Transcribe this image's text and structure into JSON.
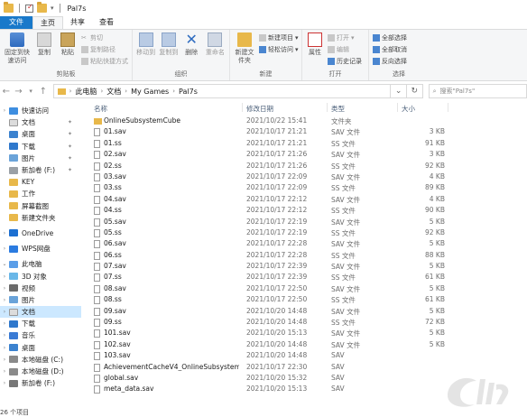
{
  "titlebar": {
    "title": "Pal7s"
  },
  "tabs": [
    {
      "label": "文件"
    },
    {
      "label": "主页"
    },
    {
      "label": "共享"
    },
    {
      "label": "查看"
    }
  ],
  "ribbon": {
    "clipboard": {
      "pin_label": "固定到快速访问",
      "copy_label": "复制",
      "paste_label": "粘贴",
      "cut_label": "剪切",
      "copy_path_label": "复制路径",
      "paste_shortcut_label": "粘贴快捷方式",
      "group_label": "剪贴板"
    },
    "organize": {
      "move_label": "移动到",
      "copy_to_label": "复制到",
      "delete_label": "删除",
      "rename_label": "重命名",
      "group_label": "组织"
    },
    "new": {
      "new_folder_label": "新建文件夹",
      "new_item_label": "新建项目",
      "easy_access_label": "轻松访问",
      "group_label": "新建"
    },
    "open": {
      "properties_label": "属性",
      "open_label": "打开",
      "edit_label": "编辑",
      "history_label": "历史记录",
      "group_label": "打开"
    },
    "select": {
      "select_all_label": "全部选择",
      "select_none_label": "全部取消",
      "invert_label": "反向选择",
      "group_label": "选择"
    }
  },
  "address": {
    "crumbs": [
      "此电脑",
      "文档",
      "My Games",
      "Pal7s"
    ],
    "search_placeholder": "搜索\"Pal7s\""
  },
  "sidebar": {
    "items": [
      {
        "label": "快速访问",
        "icon": "star-icon"
      },
      {
        "label": "文档",
        "icon": "document-icon",
        "pinned": true
      },
      {
        "label": "桌面",
        "icon": "desktop-icon",
        "pinned": true
      },
      {
        "label": "下载",
        "icon": "download-icon",
        "pinned": true
      },
      {
        "label": "图片",
        "icon": "pictures-icon",
        "pinned": true
      },
      {
        "label": "新加卷 (F:)",
        "icon": "drive-icon",
        "pinned": true
      },
      {
        "label": "KEY",
        "icon": "folder-icon"
      },
      {
        "label": "工作",
        "icon": "folder-icon"
      },
      {
        "label": "屏幕截图",
        "icon": "folder-icon"
      },
      {
        "label": "新建文件夹",
        "icon": "folder-icon"
      },
      {
        "label": "OneDrive",
        "icon": "cloud-icon"
      },
      {
        "label": "WPS网盘",
        "icon": "wps-cloud-icon"
      },
      {
        "label": "此电脑",
        "icon": "computer-icon"
      },
      {
        "label": "3D 对象",
        "icon": "3d-objects-icon"
      },
      {
        "label": "视频",
        "icon": "video-icon"
      },
      {
        "label": "图片",
        "icon": "pictures-icon"
      },
      {
        "label": "文档",
        "icon": "document-icon"
      },
      {
        "label": "下载",
        "icon": "download-icon"
      },
      {
        "label": "音乐",
        "icon": "music-icon"
      },
      {
        "label": "桌面",
        "icon": "desktop-icon"
      },
      {
        "label": "本地磁盘 (C:)",
        "icon": "hard-drive-icon"
      },
      {
        "label": "本地磁盘 (D:)",
        "icon": "hard-drive-icon"
      },
      {
        "label": "新加卷 (F:)",
        "icon": "drive-icon"
      }
    ]
  },
  "columns": {
    "name": "名称",
    "date": "修改日期",
    "type": "类型",
    "size": "大小"
  },
  "files": [
    {
      "name": "OnlineSubsystemCube",
      "date": "2021/10/22 15:41",
      "type": "文件夹",
      "size": "",
      "folder": true
    },
    {
      "name": "01.sav",
      "date": "2021/10/17 21:21",
      "type": "SAV 文件",
      "size": "3 KB"
    },
    {
      "name": "01.ss",
      "date": "2021/10/17 21:21",
      "type": "SS 文件",
      "size": "91 KB"
    },
    {
      "name": "02.sav",
      "date": "2021/10/17 21:26",
      "type": "SAV 文件",
      "size": "3 KB"
    },
    {
      "name": "02.ss",
      "date": "2021/10/17 21:26",
      "type": "SS 文件",
      "size": "92 KB"
    },
    {
      "name": "03.sav",
      "date": "2021/10/17 22:09",
      "type": "SAV 文件",
      "size": "4 KB"
    },
    {
      "name": "03.ss",
      "date": "2021/10/17 22:09",
      "type": "SS 文件",
      "size": "89 KB"
    },
    {
      "name": "04.sav",
      "date": "2021/10/17 22:12",
      "type": "SAV 文件",
      "size": "4 KB"
    },
    {
      "name": "04.ss",
      "date": "2021/10/17 22:12",
      "type": "SS 文件",
      "size": "90 KB"
    },
    {
      "name": "05.sav",
      "date": "2021/10/17 22:19",
      "type": "SAV 文件",
      "size": "5 KB"
    },
    {
      "name": "05.ss",
      "date": "2021/10/17 22:19",
      "type": "SS 文件",
      "size": "92 KB"
    },
    {
      "name": "06.sav",
      "date": "2021/10/17 22:28",
      "type": "SAV 文件",
      "size": "5 KB"
    },
    {
      "name": "06.ss",
      "date": "2021/10/17 22:28",
      "type": "SS 文件",
      "size": "88 KB"
    },
    {
      "name": "07.sav",
      "date": "2021/10/17 22:39",
      "type": "SAV 文件",
      "size": "5 KB"
    },
    {
      "name": "07.ss",
      "date": "2021/10/17 22:39",
      "type": "SS 文件",
      "size": "61 KB"
    },
    {
      "name": "08.sav",
      "date": "2021/10/17 22:50",
      "type": "SAV 文件",
      "size": "5 KB"
    },
    {
      "name": "08.ss",
      "date": "2021/10/17 22:50",
      "type": "SS 文件",
      "size": "61 KB"
    },
    {
      "name": "09.sav",
      "date": "2021/10/20 14:48",
      "type": "SAV 文件",
      "size": "5 KB"
    },
    {
      "name": "09.ss",
      "date": "2021/10/20 14:48",
      "type": "SS 文件",
      "size": "72 KB"
    },
    {
      "name": "101.sav",
      "date": "2021/10/20 15:13",
      "type": "SAV 文件",
      "size": "5 KB"
    },
    {
      "name": "102.sav",
      "date": "2021/10/20 14:48",
      "type": "SAV 文件",
      "size": "5 KB"
    },
    {
      "name": "103.sav",
      "date": "2021/10/20 14:48",
      "type": "SAV",
      "size": ""
    },
    {
      "name": "AchievementCacheV4_OnlineSubsystemCu...",
      "date": "2021/10/17 22:30",
      "type": "SAV",
      "size": ""
    },
    {
      "name": "global.sav",
      "date": "2021/10/20 15:32",
      "type": "SAV",
      "size": ""
    },
    {
      "name": "meta_data.sav",
      "date": "2021/10/20 15:13",
      "type": "SAV",
      "size": ""
    }
  ],
  "status": {
    "item_count": "26 个项目"
  },
  "colors": {
    "accent": "#1979ca",
    "selection": "#cce8ff",
    "folder": "#e8b84a"
  }
}
